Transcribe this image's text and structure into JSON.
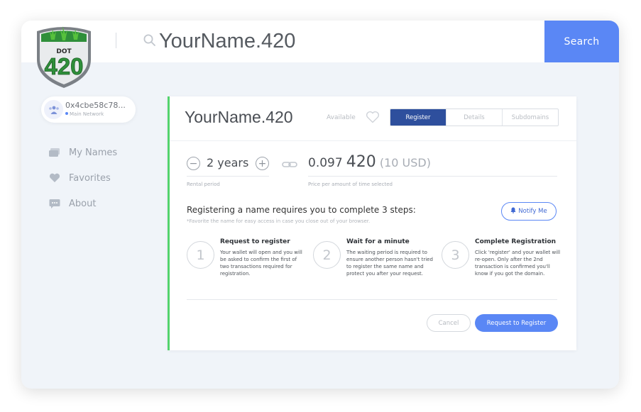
{
  "brand": {
    "logo_text_top": "DOT",
    "logo_text_main": "420",
    "accent": "#5a87f5",
    "success": "#53d36d"
  },
  "search": {
    "query": "YourName.420",
    "button_label": "Search"
  },
  "account": {
    "address": "0x4cbe58c78...",
    "network": "Main Network"
  },
  "sidebar": {
    "items": [
      {
        "label": "My Names",
        "icon": "cards-icon"
      },
      {
        "label": "Favorites",
        "icon": "heart-icon"
      },
      {
        "label": "About",
        "icon": "chat-bubble-icon"
      }
    ]
  },
  "domain": {
    "name": "YourName.420",
    "availability": "Available",
    "tabs": [
      {
        "label": "Register",
        "active": true
      },
      {
        "label": "Details",
        "active": false
      },
      {
        "label": "Subdomains",
        "active": false
      }
    ]
  },
  "rental": {
    "duration": "2 years",
    "label": "Rental period"
  },
  "price": {
    "eth_prefix": "0.097",
    "eth_main": "420",
    "usd": "(10 USD)",
    "label": "Price per amount of time selected"
  },
  "steps": {
    "heading": "Registering a name requires you to complete 3 steps:",
    "note": "*Favorite the name for easy access in case you close out of your browser.",
    "notify_label": "Notify Me",
    "items": [
      {
        "number": "1",
        "title": "Request to register",
        "description": "Your wallet will open and you will be asked to confirm the first of two transactions required for registration."
      },
      {
        "number": "2",
        "title": "Wait for a minute",
        "description": "The waiting period is required to ensure another person hasn't tried to register the same name and protect you after your request."
      },
      {
        "number": "3",
        "title": "Complete Registration",
        "description": "Click 'register' and your wallet will re-open. Only after the 2nd transaction is confirmed you'll know if you got the domain."
      }
    ]
  },
  "actions": {
    "cancel": "Cancel",
    "request": "Request to Register"
  }
}
